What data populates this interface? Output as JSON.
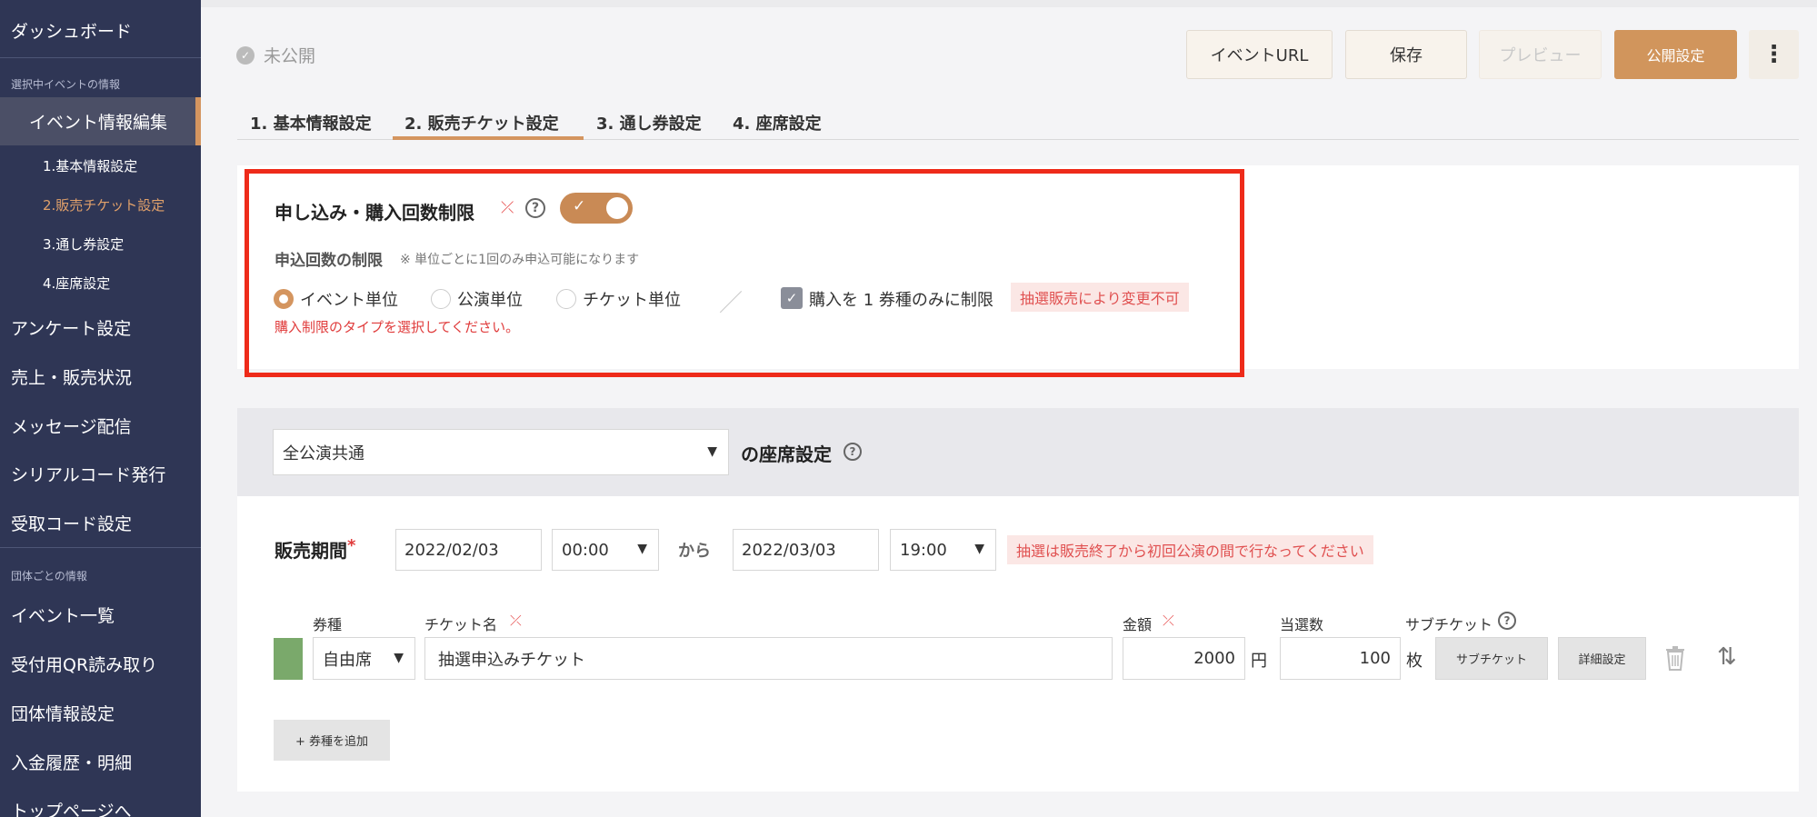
{
  "sidebar": {
    "dashboard": "ダッシュボード",
    "section_event": "選択中イベントの情報",
    "event_edit": "イベント情報編集",
    "sub": [
      "1.基本情報設定",
      "2.販売チケット設定",
      "3.通し券設定",
      "4.座席設定"
    ],
    "items_a": [
      "アンケート設定",
      "売上・販売状況",
      "メッセージ配信",
      "シリアルコード発行",
      "受取コード設定"
    ],
    "section_org": "団体ごとの情報",
    "items_b": [
      "イベント一覧",
      "受付用QR読み取り",
      "団体情報設定",
      "入金履歴・明細",
      "トップページへ"
    ]
  },
  "header": {
    "status": "未公開",
    "event_url": "イベントURL",
    "save": "保存",
    "preview": "プレビュー",
    "publish": "公開設定",
    "more": "⋮"
  },
  "tabs": [
    "1. 基本情報設定",
    "2. 販売チケット設定",
    "3. 通し券設定",
    "4. 座席設定"
  ],
  "limit": {
    "title": "申し込み・購入回数制限",
    "count_label": "申込回数の制限",
    "count_note": "※ 単位ごとに1回のみ申込可能になります",
    "radio_event": "イベント単位",
    "radio_show": "公演単位",
    "radio_ticket": "チケット単位",
    "check_label": "購入を 1 券種のみに制限",
    "badge": "抽選販売により変更不可",
    "error": "購入制限のタイプを選択してください。"
  },
  "seat": {
    "select_value": "全公演共通",
    "title": "の座席設定"
  },
  "period": {
    "label": "販売期間",
    "start_date": "2022/02/03",
    "start_time": "00:00",
    "kara": "から",
    "end_date": "2022/03/03",
    "end_time": "19:00",
    "note": "抽選は販売終了から初回公演の間で行なってください"
  },
  "ticket": {
    "col_type": "券種",
    "col_name": "チケット名",
    "col_price": "金額",
    "col_winners": "当選数",
    "col_sub": "サブチケット",
    "type_value": "自由席",
    "name_value": "抽選申込みチケット",
    "price_value": "2000",
    "yen": "円",
    "winners_value": "100",
    "mai": "枚",
    "sub_button": "サブチケット",
    "detail_button": "詳細設定",
    "add_button": "+ 券種を追加",
    "swatch_color": "#7aa96b"
  }
}
